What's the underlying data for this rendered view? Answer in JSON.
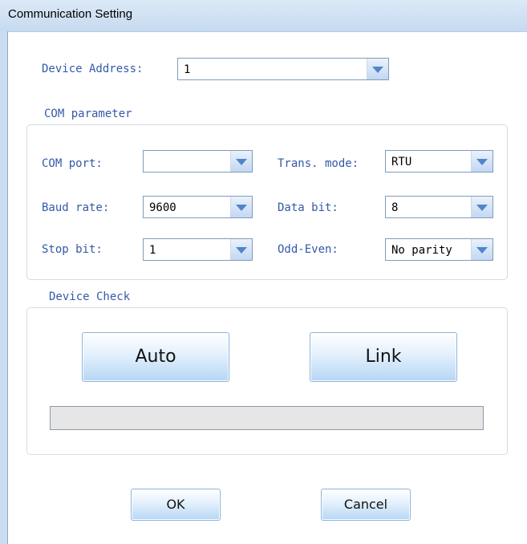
{
  "window": {
    "title": "Communication Setting"
  },
  "device_address": {
    "label": "Device Address:",
    "value": "1"
  },
  "com_parameter": {
    "group_title": "COM parameter",
    "com_port": {
      "label": "COM port:",
      "value": ""
    },
    "trans_mode": {
      "label": "Trans. mode:",
      "value": "RTU"
    },
    "baud_rate": {
      "label": "Baud rate:",
      "value": "9600"
    },
    "data_bit": {
      "label": "Data bit:",
      "value": "8"
    },
    "stop_bit": {
      "label": "Stop bit:",
      "value": "1"
    },
    "odd_even": {
      "label": "Odd-Even:",
      "value": "No parity"
    }
  },
  "device_check": {
    "group_title": "Device Check",
    "auto_label": "Auto",
    "link_label": "Link",
    "progress_percent": 0
  },
  "footer": {
    "ok_label": "OK",
    "cancel_label": "Cancel"
  },
  "colors": {
    "label_text": "#335aa8",
    "title_bar": "#c6daf0",
    "button_gradient_end": "#b6d6f5",
    "combo_arrow": "#4e86c9"
  }
}
